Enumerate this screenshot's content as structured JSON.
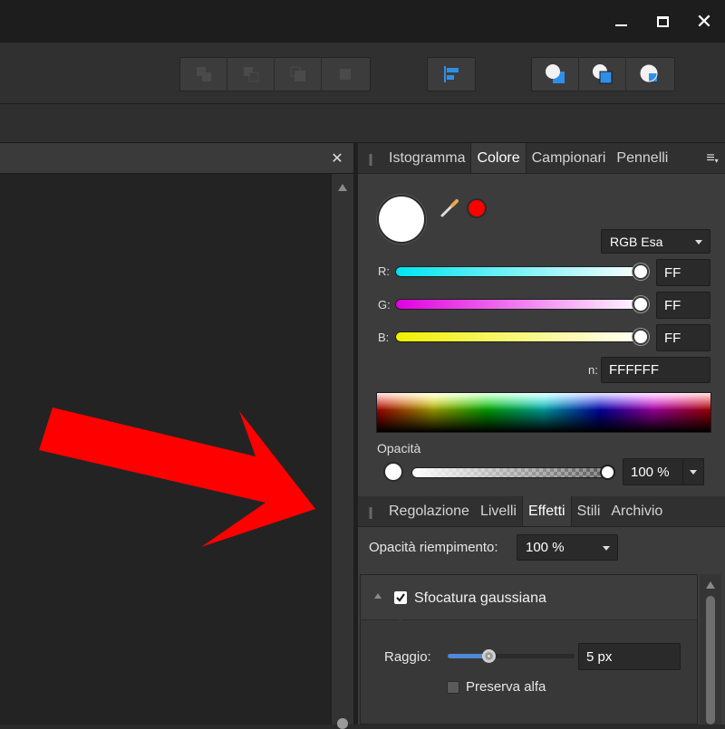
{
  "window": {
    "minimize_icon": "minimize-icon",
    "maximize_icon": "maximize-icon",
    "close_icon": "close-icon"
  },
  "toolbar": {
    "boolean_group_icons": [
      "add-shapes-icon",
      "subtract-shapes-icon",
      "intersect-shapes-icon",
      "divide-shapes-icon"
    ],
    "align_icon": "align-left-icon",
    "arrange_group_icons": [
      "move-to-back-icon",
      "move-to-front-icon",
      "insert-inside-icon"
    ]
  },
  "document_tab": {
    "close_glyph": "✕"
  },
  "color_panel": {
    "tabs": [
      "Istogramma",
      "Colore",
      "Campionari",
      "Pennelli"
    ],
    "active_tab": "Colore",
    "grip": "||",
    "menu_glyph": "≡",
    "current_color": "#FFFFFF",
    "secondary_color": "#FF0000",
    "model": "RGB Esa",
    "r_label": "R:",
    "r_value": "FF",
    "g_label": "G:",
    "g_value": "FF",
    "b_label": "B:",
    "b_value": "FF",
    "hex_label": "n:",
    "hex_value": "FFFFFF",
    "opacity_label": "Opacità",
    "opacity_value": "100 %"
  },
  "effects_panel": {
    "tabs": [
      "Regolazione",
      "Livelli",
      "Effetti",
      "Stili",
      "Archivio"
    ],
    "active_tab": "Effetti",
    "grip": "||",
    "fill_opacity_label": "Opacità riempimento:",
    "fill_opacity_value": "100 %",
    "effect_name": "Sfocatura gaussiana",
    "effect_enabled": true,
    "radius_label": "Raggio:",
    "radius_value": "5 px",
    "radius_fraction": 0.32,
    "preserve_alpha_label": "Preserva alfa",
    "preserve_alpha_checked": false
  },
  "annotation": {
    "arrow_color": "#FF0000"
  }
}
